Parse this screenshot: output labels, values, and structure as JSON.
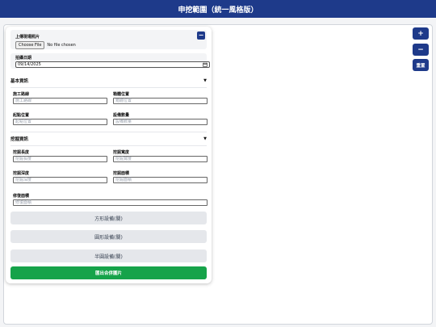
{
  "header": {
    "title": "申挖範圍（統一風格版）"
  },
  "upload": {
    "label": "上傳現場照片",
    "file_button": "Choose File",
    "file_status": "No file chosen",
    "collapse_symbol": "−"
  },
  "date": {
    "label": "拍攝日期",
    "value": "09/14/2025"
  },
  "basic": {
    "title": "基本資訊",
    "road": {
      "label": "施工路線",
      "placeholder": "施工路線"
    },
    "cabinet": {
      "label": "箱體位置",
      "placeholder": "箱體位置"
    },
    "start": {
      "label": "起點位置",
      "placeholder": "起點位置"
    },
    "equip_qty": {
      "label": "設備數量",
      "placeholder": "設備數量"
    }
  },
  "dig": {
    "title": "挖掘資訊",
    "length": {
      "label": "挖掘長度",
      "placeholder": "挖掘長度"
    },
    "width": {
      "label": "挖掘寬度",
      "placeholder": "挖掘寬度"
    },
    "depth": {
      "label": "挖掘深度",
      "placeholder": "挖掘深度"
    },
    "area": {
      "label": "挖掘面積",
      "placeholder": "挖掘面積"
    },
    "repair": {
      "label": "修復面積",
      "placeholder": "修復面積"
    }
  },
  "buttons": {
    "square": "方形設備(關)",
    "circle": "圓形設備(關)",
    "half_circle": "半圓設備(關)",
    "export": "匯出合併圖片"
  },
  "zoom": {
    "in": "+",
    "out": "−",
    "reset": "重置"
  },
  "icons": {
    "collapse": "minus-icon",
    "section_toggle": "triangle-down-icon",
    "calendar": "calendar-icon"
  },
  "colors": {
    "primary": "#1e3a8a",
    "export": "#16a34a"
  }
}
